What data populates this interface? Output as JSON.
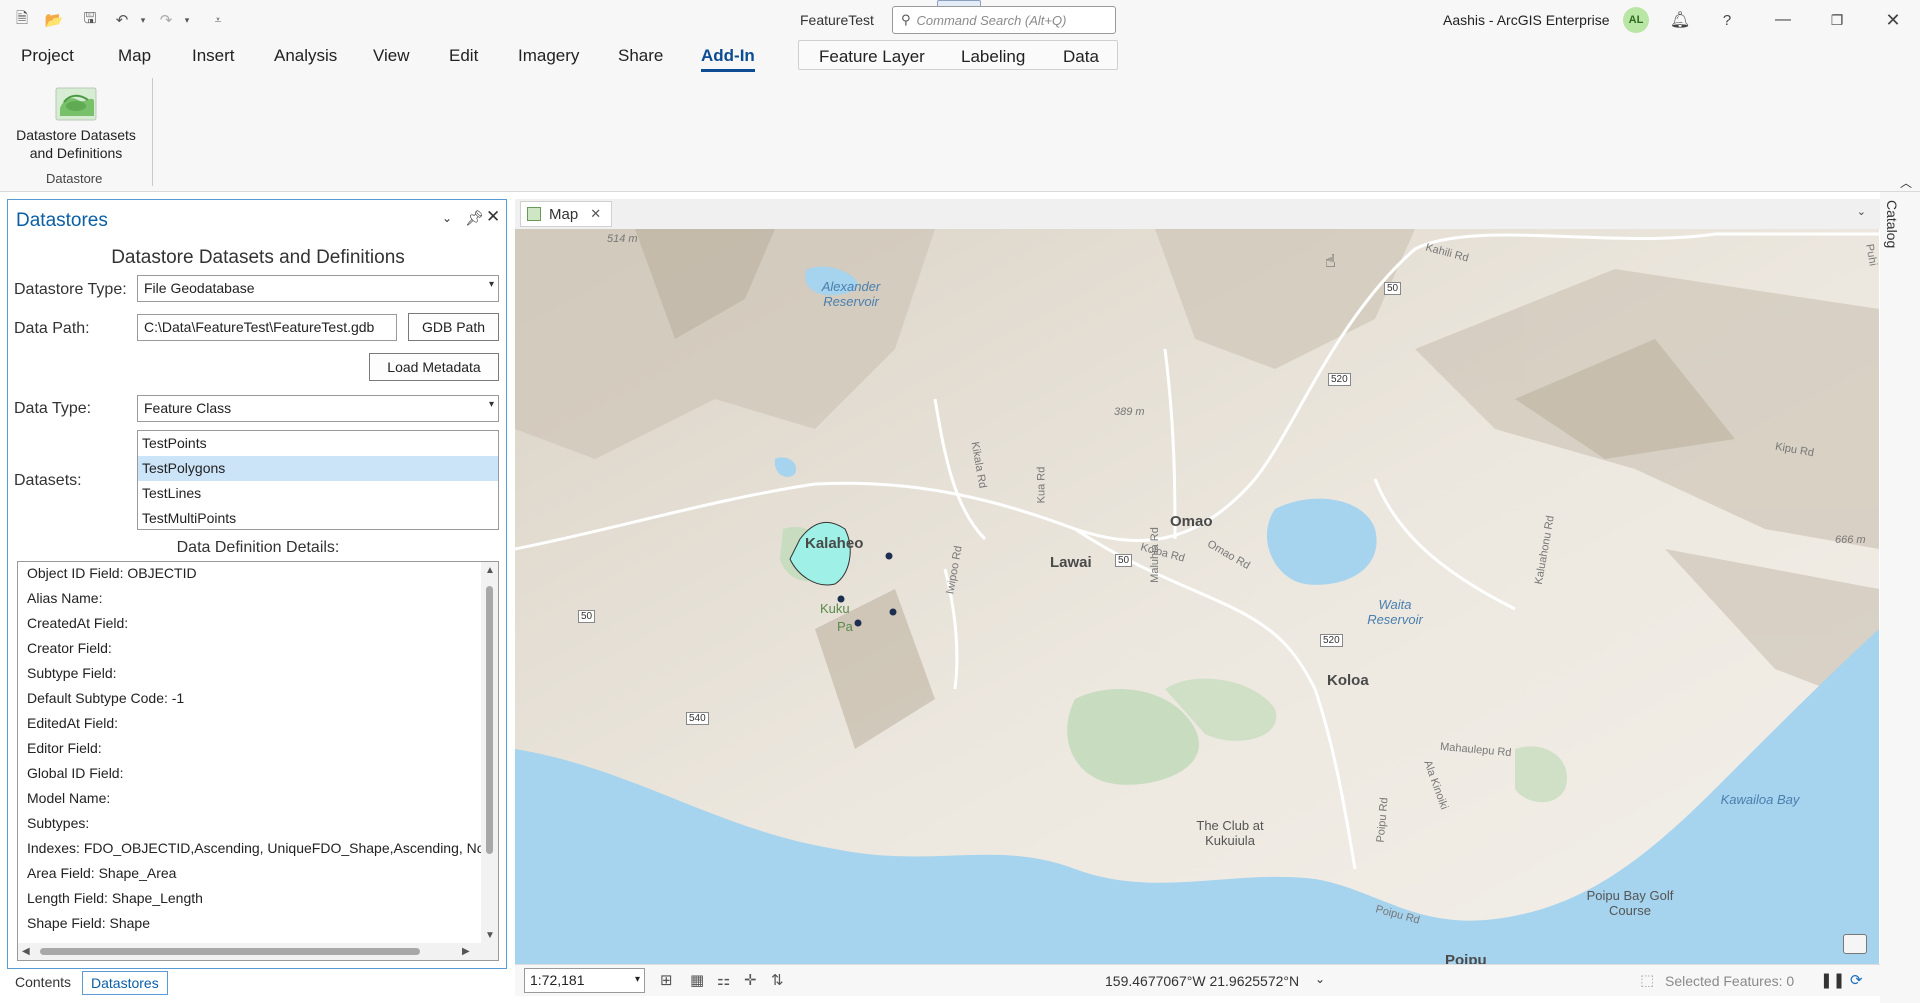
{
  "titlebar": {
    "app_title": "FeatureTest",
    "search_placeholder": "Command Search (Alt+Q)",
    "user": "Aashis - ArcGIS Enterprise",
    "avatar_initials": "AL"
  },
  "ribbon": {
    "tabs": [
      "Project",
      "Map",
      "Insert",
      "Analysis",
      "View",
      "Edit",
      "Imagery",
      "Share",
      "Add-In"
    ],
    "active_tab": "Add-In",
    "context_tabs": [
      "Feature Layer",
      "Labeling",
      "Data"
    ],
    "button_label_line1": "Datastore Datasets",
    "button_label_line2": "and Definitions",
    "group_label": "Datastore"
  },
  "pane": {
    "title": "Datastores",
    "heading": "Datastore Datasets and Definitions",
    "datastore_type_label": "Datastore Type:",
    "datastore_type_value": "File Geodatabase",
    "data_path_label": "Data Path:",
    "data_path_value": "C:\\Data\\FeatureTest\\FeatureTest.gdb",
    "gdb_path_button": "GDB Path",
    "load_metadata_button": "Load Metadata",
    "data_type_label": "Data Type:",
    "data_type_value": "Feature Class",
    "datasets_label": "Datasets:",
    "datasets": [
      "TestPoints",
      "TestPolygons",
      "TestLines",
      "TestMultiPoints"
    ],
    "selected_dataset": "TestPolygons",
    "details_label": "Data Definition Details:",
    "details": [
      "Object ID Field: OBJECTID",
      "Alias Name:",
      "CreatedAt Field:",
      "Creator Field:",
      "Subtype Field:",
      "Default Subtype Code: -1",
      "EditedAt Field:",
      "Editor Field:",
      "Global ID Field:",
      "Model Name:",
      "Subtypes:",
      "Indexes: FDO_OBJECTID,Ascending, UniqueFDO_Shape,Ascending, No",
      "Area Field: Shape_Area",
      "Length Field: Shape_Length",
      "Shape Field: Shape"
    ]
  },
  "bottom_tabs": [
    "Contents",
    "Datastores"
  ],
  "active_bottom_tab": "Datastores",
  "map": {
    "tab_label": "Map",
    "catalog_label": "Catalog",
    "places": [
      "Kalaheo",
      "Lawai",
      "Omao",
      "Koloa",
      "Poipu"
    ],
    "water_labels": [
      "Alexander Reservoir",
      "Waita Reservoir",
      "Kawailoa Bay"
    ],
    "roads": [
      "Kahili Rd",
      "Kipu Rd",
      "Kikala Rd",
      "Kua Rd",
      "Maluhia Rd",
      "Koloa Rd",
      "Omao Rd",
      "Iwipoo Rd",
      "Kaluahonu Rd",
      "Mahaulepu Rd",
      "Poipu Rd",
      "Ala Kinoiki",
      "Poipu Rd"
    ],
    "elevations": [
      "514 m",
      "389 m",
      "666 m"
    ],
    "shields": [
      "50",
      "520",
      "50",
      "50",
      "520",
      "540"
    ],
    "pois": [
      "The Club at Kukuiula",
      "Poipu Bay Golf Course"
    ],
    "partial_label_1": "Kuku",
    "partial_label_2": "Pa",
    "partial_label_3": "Puhi"
  },
  "statusbar": {
    "scale": "1:72,181",
    "coordinates": "159.4677067°W 21.9625572°N",
    "selected_features": "Selected Features: 0"
  }
}
